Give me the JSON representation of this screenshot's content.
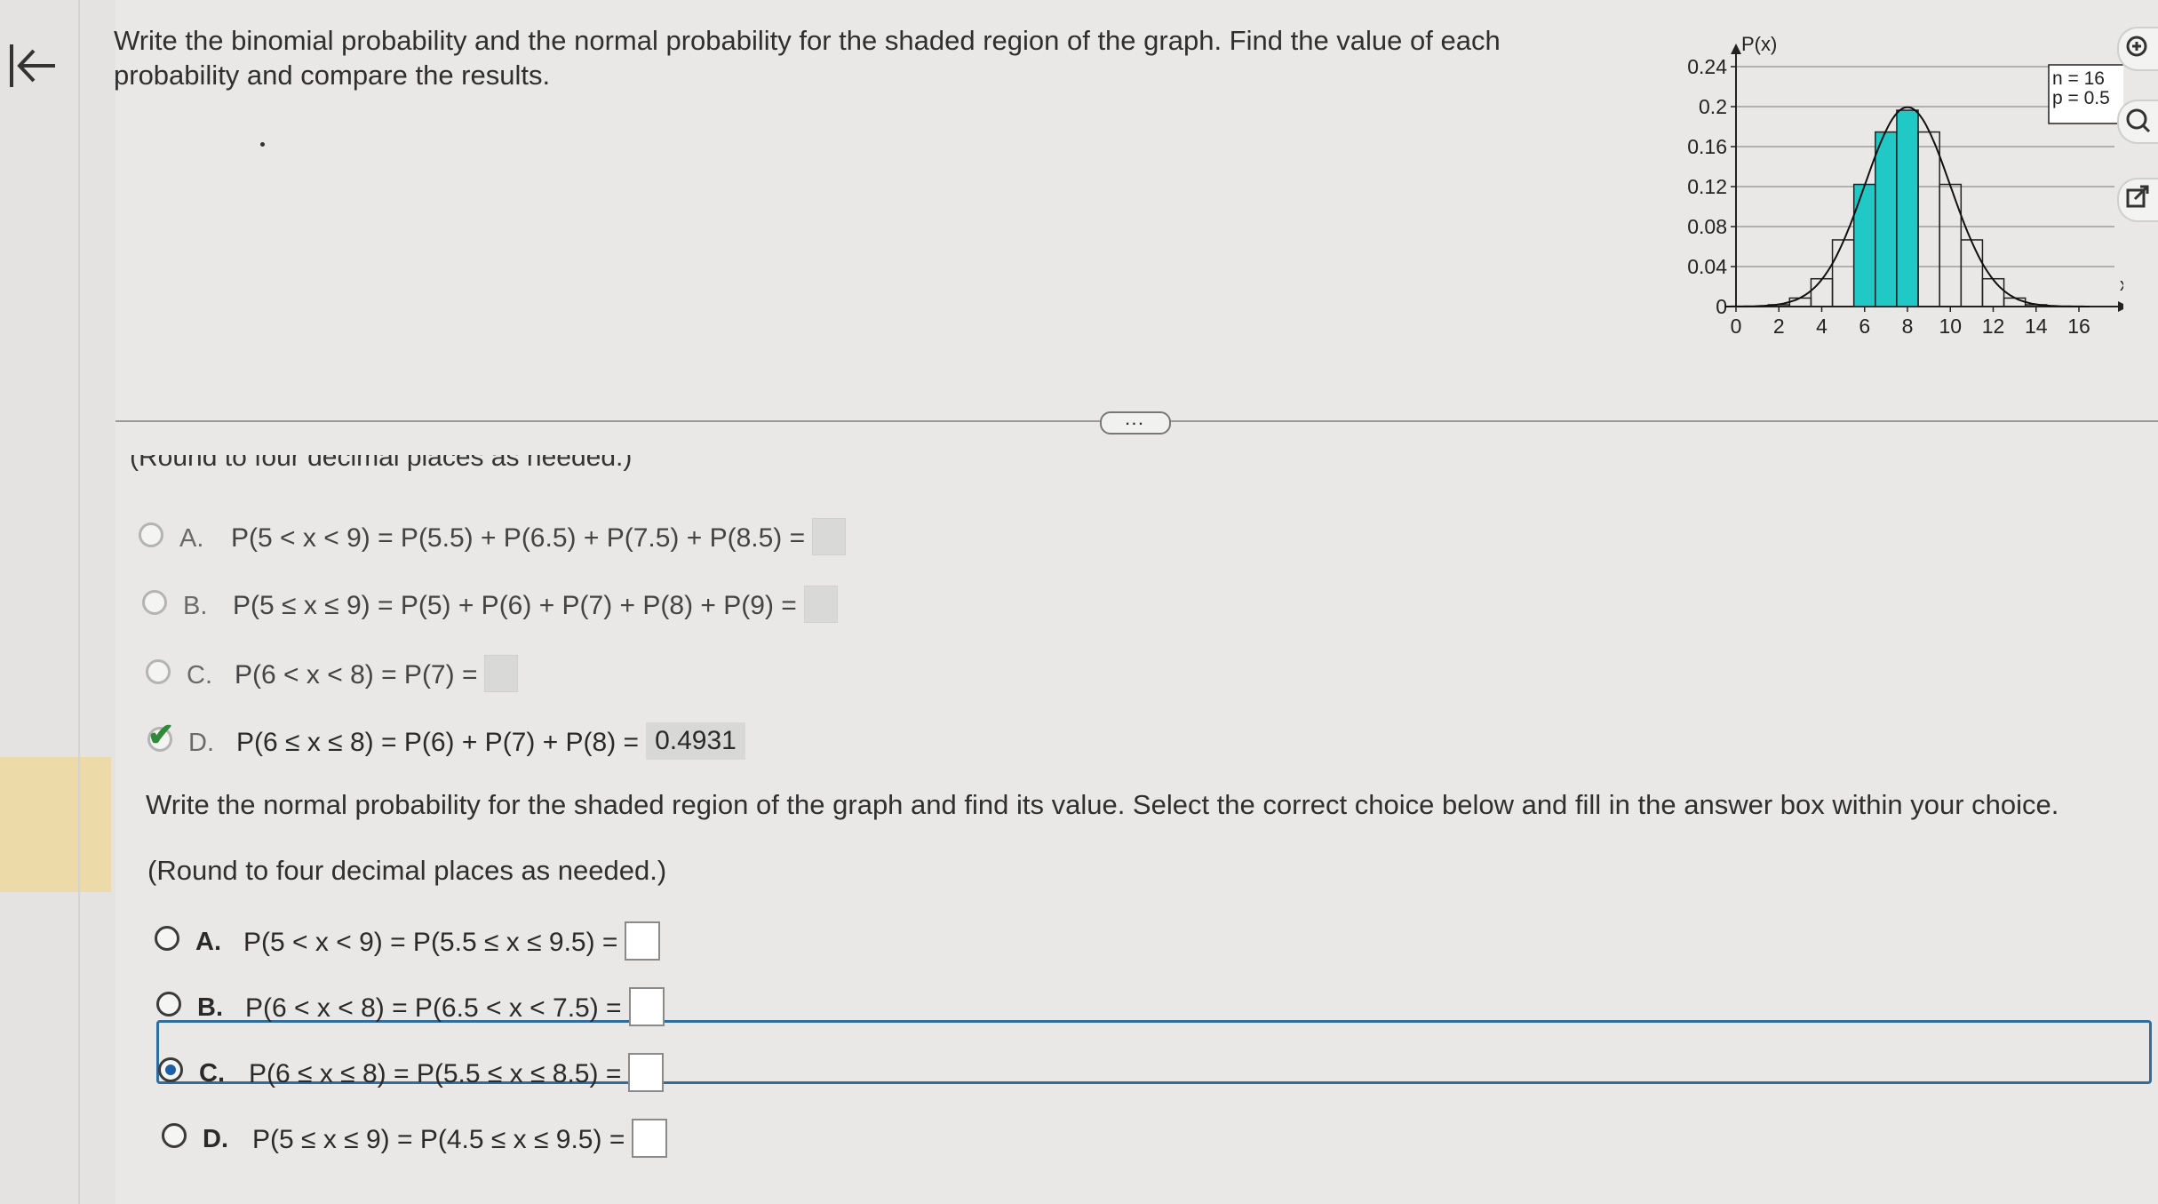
{
  "question": {
    "text": "Write the binomial probability and the normal probability for the shaded region of the graph. Find the value of each probability and compare the results."
  },
  "binomial_section": {
    "cutoff_text": "(Round to four decimal places as needed.)",
    "choices": [
      {
        "letter": "A.",
        "expr": "P(5 < x < 9) = P(5.5) + P(6.5) + P(7.5) + P(8.5) =",
        "answer": ""
      },
      {
        "letter": "B.",
        "expr": "P(5 ≤ x ≤ 9) = P(5) + P(6) + P(7) + P(8) + P(9) =",
        "answer": ""
      },
      {
        "letter": "C.",
        "expr": "P(6 < x < 8) = P(7) =",
        "answer": ""
      },
      {
        "letter": "D.",
        "expr": "P(6 ≤ x ≤ 8) = P(6) + P(7) + P(8) =",
        "answer": "0.4931"
      }
    ]
  },
  "normal_section": {
    "prompt": "Write the normal probability for the shaded region of the graph and find its value. Select the correct choice below and fill in the answer box within your choice.",
    "round_note": "(Round to four decimal places as needed.)",
    "choices": [
      {
        "letter": "A.",
        "expr": "P(5 < x < 9) = P(5.5 ≤ x ≤ 9.5) ="
      },
      {
        "letter": "B.",
        "expr": "P(6 < x < 8) = P(6.5 < x < 7.5) ="
      },
      {
        "letter": "C.",
        "expr": "P(6 ≤ x ≤ 8) = P(5.5 ≤ x ≤ 8.5) ="
      },
      {
        "letter": "D.",
        "expr": "P(5 ≤ x ≤ 9) = P(4.5 ≤ x ≤ 9.5) ="
      }
    ]
  },
  "expander_label": "...",
  "colors": {
    "shaded": "#21c9c6",
    "accent": "#2f6da0",
    "check": "#2f8a3a"
  },
  "icons": {
    "back": "back-arrow-icon",
    "zoom_in": "zoom-in-icon",
    "zoom_out": "zoom-out-icon",
    "popout": "popout-icon"
  },
  "chart_data": {
    "type": "bar",
    "ylabel": "P(x)",
    "xlabel": "x",
    "x": [
      0,
      1,
      2,
      3,
      4,
      5,
      6,
      7,
      8,
      9,
      10,
      11,
      12,
      13,
      14,
      15,
      16
    ],
    "values": [
      0.0,
      0.0002,
      0.0018,
      0.0085,
      0.0278,
      0.0667,
      0.1222,
      0.1746,
      0.1964,
      0.1746,
      0.1222,
      0.0667,
      0.0278,
      0.0085,
      0.0018,
      0.0002,
      0.0
    ],
    "shaded_x": [
      6,
      7,
      8
    ],
    "xticks": [
      "0",
      "2",
      "4",
      "6",
      "8",
      "10",
      "12",
      "14",
      "16"
    ],
    "yticks": [
      "0",
      "0.04",
      "0.08",
      "0.12",
      "0.16",
      "0.2",
      "0.24"
    ],
    "ylim": [
      0,
      0.24
    ],
    "xlim": [
      0,
      16
    ],
    "legend": [
      "n = 16",
      "p = 0.5"
    ],
    "normal_curve": true,
    "grid": true
  }
}
